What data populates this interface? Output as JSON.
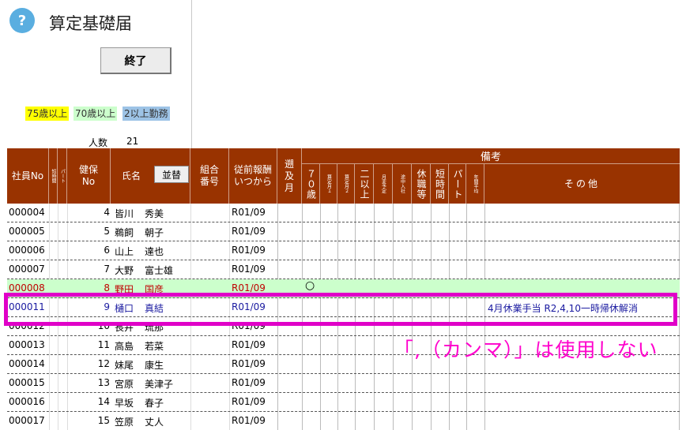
{
  "app": {
    "title": "算定基礎届",
    "help_icon_glyph": "?"
  },
  "toolbar": {
    "end_label": "終了"
  },
  "legend": {
    "age75": "75歳以上",
    "age70": "70歳以上",
    "multi": "2以上勤務"
  },
  "headcount": {
    "label": "人数",
    "value": "21"
  },
  "header": {
    "employee_no": "社員No",
    "tiny1": "短時間",
    "tiny2": "パート",
    "kenpo": "健保\nNo",
    "name": "氏名",
    "sort_label": "並替",
    "kumiai": "組合\n番号",
    "prev_salary": "従前報酬\nいつから",
    "retro": "遡\n及\n月",
    "bikou": "備考",
    "b70": "７０歳",
    "b_month1": "算定月１",
    "b_month2": "算定月２",
    "b_two": "二以上",
    "b_change": "月変予定",
    "b_mid": "途中入社",
    "b_leave": "休職等",
    "b_short": "短時間",
    "b_part": "パート",
    "b_avg": "年間平均",
    "b_other": "その他"
  },
  "rows": [
    {
      "no": "000004",
      "kenpo": "4",
      "last": "皆川",
      "first": "秀美",
      "date": "R01/09",
      "note": "",
      "mark": "",
      "style": ""
    },
    {
      "no": "000005",
      "kenpo": "5",
      "last": "鵜飼",
      "first": "朝子",
      "date": "R01/09",
      "note": "",
      "mark": "",
      "style": ""
    },
    {
      "no": "000006",
      "kenpo": "6",
      "last": "山上",
      "first": "達也",
      "date": "R01/09",
      "note": "",
      "mark": "",
      "style": ""
    },
    {
      "no": "000007",
      "kenpo": "7",
      "last": "大野",
      "first": "富士雄",
      "date": "R01/09",
      "note": "",
      "mark": "",
      "style": ""
    },
    {
      "no": "000008",
      "kenpo": "8",
      "last": "野田",
      "first": "国彦",
      "date": "R01/09",
      "note": "",
      "mark": "○",
      "style": "green red"
    },
    {
      "no": "000011",
      "kenpo": "9",
      "last": "樋口",
      "first": "真結",
      "date": "R01/09",
      "note": "4月休業手当  R2,4,10一時帰休解消",
      "mark": "",
      "style": "blue"
    },
    {
      "no": "000012",
      "kenpo": "10",
      "last": "長井",
      "first": "琉那",
      "date": "R01/09",
      "note": "",
      "mark": "",
      "style": ""
    },
    {
      "no": "000013",
      "kenpo": "11",
      "last": "高島",
      "first": "若菜",
      "date": "R01/09",
      "note": "",
      "mark": "",
      "style": ""
    },
    {
      "no": "000014",
      "kenpo": "12",
      "last": "妹尾",
      "first": "康生",
      "date": "R01/09",
      "note": "",
      "mark": "",
      "style": ""
    },
    {
      "no": "000015",
      "kenpo": "13",
      "last": "宮原",
      "first": "美津子",
      "date": "R01/09",
      "note": "",
      "mark": "",
      "style": ""
    },
    {
      "no": "000016",
      "kenpo": "14",
      "last": "早坂",
      "first": "春子",
      "date": "R01/09",
      "note": "",
      "mark": "",
      "style": ""
    },
    {
      "no": "000017",
      "kenpo": "15",
      "last": "笠原",
      "first": "丈人",
      "date": "R01/09",
      "note": "",
      "mark": "",
      "style": ""
    }
  ],
  "annotation": {
    "text": "「,（カンマ）」は使用しない",
    "color": "#ff00cc"
  },
  "colors": {
    "header_bg": "#993300",
    "highlight": "#e000c8",
    "legend75": "#ffff00",
    "legend70": "#ccffcc",
    "legend2": "#9dc3e6"
  }
}
